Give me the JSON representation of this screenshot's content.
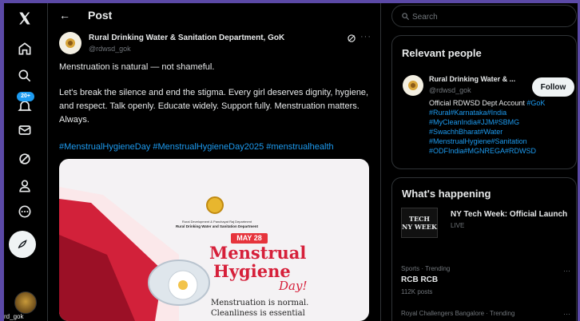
{
  "nav": {
    "notifications_badge": "20+",
    "account_handle": "rd_gok"
  },
  "header": {
    "back_label": "←",
    "title": "Post"
  },
  "post": {
    "author_name": "Rural Drinking Water & Sanitation Department, GoK",
    "author_handle": "@rdwsd_gok",
    "more_label": "···",
    "text_line1": "Menstruation is natural — not shameful.",
    "text_para2": "Let's break the silence and end the stigma. Every girl deserves dignity, hygiene, and respect. Talk openly. Educate widely. Support fully. Menstruation matters. Always.",
    "hashtags": "#MenstrualHygieneDay #MenstrualHygieneDay2025 #menstrualhealth",
    "media": {
      "dept_line1": "Rural Development & Panchayat Raj Department",
      "dept_line2": "Rural Drinking Water and Sanitation Department",
      "date_badge": "MAY 28",
      "headline1": "Menstrual",
      "headline2": "Hygiene",
      "headline3": "Day!",
      "line1": "Menstruation is normal.",
      "line2": "Cleanliness is essential"
    }
  },
  "search": {
    "placeholder": "Search"
  },
  "relevant_people": {
    "title": "Relevant people",
    "name": "Rural Drinking Water & ...",
    "handle": "@rdwsd_gok",
    "follow_label": "Follow",
    "bio_text": "Official RDWSD Dept Account",
    "bio_tags": [
      "#GoK",
      "#Rural",
      "#Karnataka",
      "#India",
      "#MyCleanIndia",
      "#JJM",
      "#SBMG",
      "#SwachhBharat",
      "#Water",
      "#MenstrualHygiene",
      "#Sanitation",
      "#ODFIndia",
      "#MGNREGA",
      "#RDWSD"
    ]
  },
  "whats_happening": {
    "title": "What's happening",
    "thumb_line1": "TECH",
    "thumb_line2": "NY WEEK",
    "event_title": "NY Tech Week: Official Launch",
    "event_status": "LIVE",
    "trend1_meta": "Sports · Trending",
    "trend1_name": "RCB RCB",
    "trend1_count": "112K posts",
    "trend2_meta": "Royal Challengers Bangalore · Trending",
    "more_label": "···"
  },
  "colors": {
    "accent": "#1d9bf0",
    "background": "#000000",
    "frame": "#5b49a6",
    "brand_red": "#d6203a"
  }
}
